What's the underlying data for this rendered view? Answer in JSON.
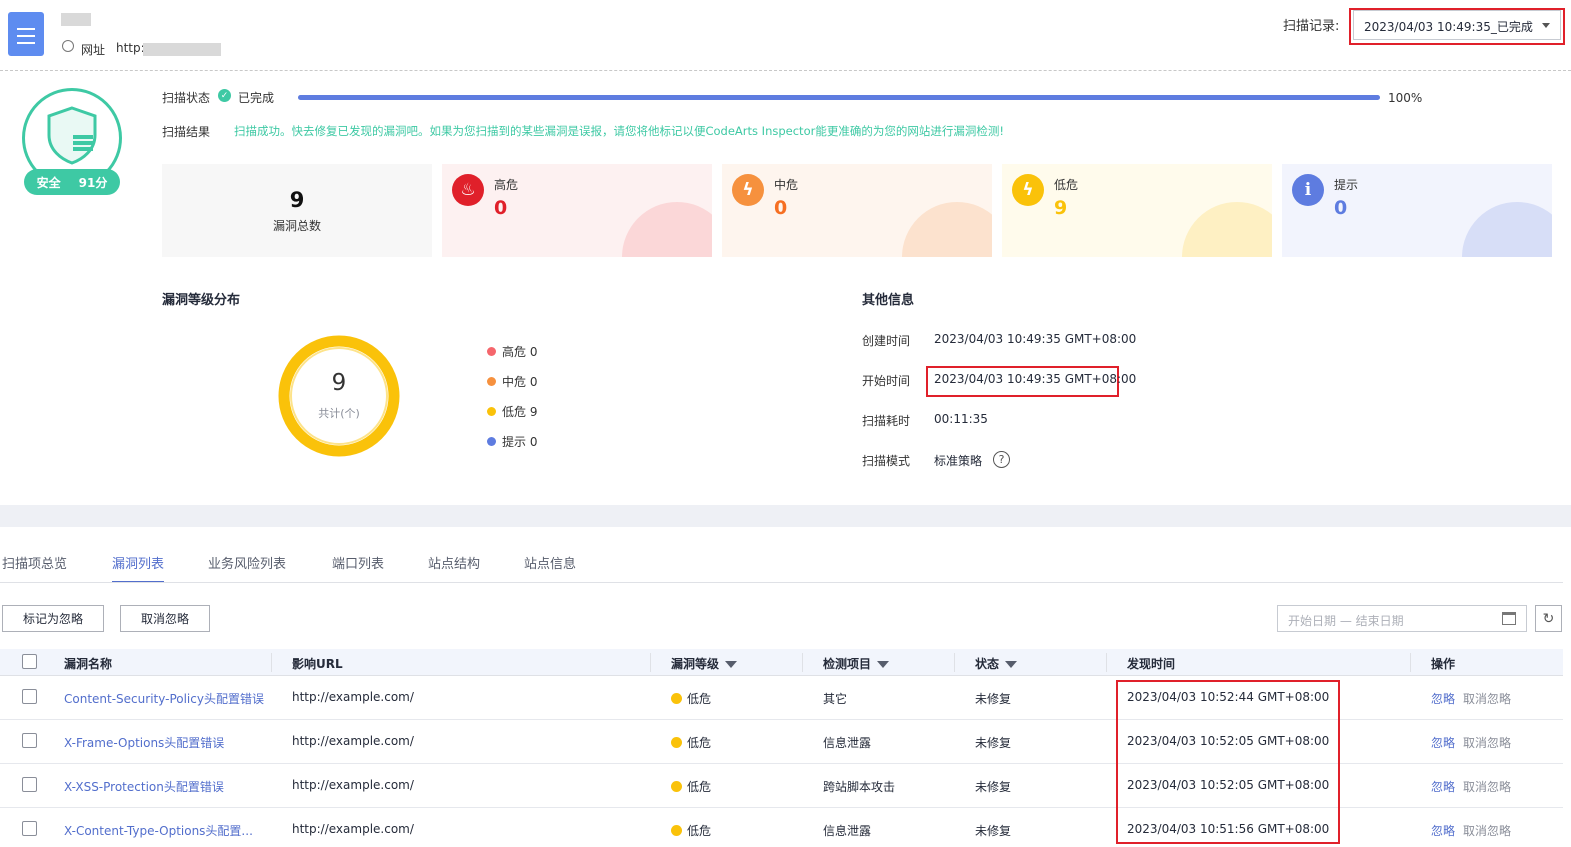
{
  "header": {
    "url_label": "网址",
    "url_prefix": "http:/",
    "scan_record_label": "扫描记录:",
    "scan_record_value": "2023/04/03 10:49:35_已完成"
  },
  "score": {
    "label": "安全",
    "value": "91分"
  },
  "scan": {
    "status_label": "扫描状态",
    "status_value": "已完成",
    "progress_percent": 100,
    "progress_text": "100%",
    "result_label": "扫描结果",
    "result_text": "扫描成功。快去修复已发现的漏洞吧。如果为您扫描到的某些漏洞是误报，请您将他标记以便CodeArts Inspector能更准确的为您的网站进行漏洞检测!"
  },
  "cards": {
    "total": {
      "value": "9",
      "label": "漏洞总数"
    },
    "high": {
      "label": "高危",
      "value": "0",
      "color": "#e0202a"
    },
    "medium": {
      "label": "中危",
      "value": "0",
      "color": "#f66f22"
    },
    "low": {
      "label": "低危",
      "value": "9",
      "color": "#fac20a"
    },
    "hint": {
      "label": "提示",
      "value": "0",
      "color": "#5e7ce0"
    }
  },
  "distribution": {
    "title": "漏洞等级分布",
    "total": "9",
    "total_label": "共计(个)",
    "legend": [
      {
        "label": "高危 0",
        "color": "#f5666c"
      },
      {
        "label": "中危 0",
        "color": "#f6913e"
      },
      {
        "label": "低危 9",
        "color": "#fac20a"
      },
      {
        "label": "提示 0",
        "color": "#5e7ce0"
      }
    ]
  },
  "other_info": {
    "title": "其他信息",
    "created_label": "创建时间",
    "created_value": "2023/04/03 10:49:35 GMT+08:00",
    "start_label": "开始时间",
    "start_value": "2023/04/03 10:49:35 GMT+08:00",
    "duration_label": "扫描耗时",
    "duration_value": "00:11:35",
    "mode_label": "扫描模式",
    "mode_value": "标准策略"
  },
  "tabs": [
    "扫描项总览",
    "漏洞列表",
    "业务风险列表",
    "端口列表",
    "站点结构",
    "站点信息"
  ],
  "toolbar": {
    "mark_ignore": "标记为忽略",
    "cancel_ignore": "取消忽略",
    "date_placeholder": "开始日期 — 结束日期"
  },
  "table": {
    "headers": [
      "漏洞名称",
      "影响URL",
      "漏洞等级",
      "检测项目",
      "状态",
      "发现时间",
      "操作"
    ],
    "rows": [
      {
        "name": "Content-Security-Policy头配置错误",
        "url": "http://example.com/",
        "level": "低危",
        "item": "其它",
        "status": "未修复",
        "time": "2023/04/03 10:52:44 GMT+08:00",
        "op1": "忽略",
        "op2": "取消忽略"
      },
      {
        "name": "X-Frame-Options头配置错误",
        "url": "http://example.com/",
        "level": "低危",
        "item": "信息泄露",
        "status": "未修复",
        "time": "2023/04/03 10:52:05 GMT+08:00",
        "op1": "忽略",
        "op2": "取消忽略"
      },
      {
        "name": "X-XSS-Protection头配置错误",
        "url": "http://example.com/",
        "level": "低危",
        "item": "跨站脚本攻击",
        "status": "未修复",
        "time": "2023/04/03 10:52:05 GMT+08:00",
        "op1": "忽略",
        "op2": "取消忽略"
      },
      {
        "name": "X-Content-Type-Options头配置...",
        "url": "http://example.com/",
        "level": "低危",
        "item": "信息泄露",
        "status": "未修复",
        "time": "2023/04/03 10:51:56 GMT+08:00",
        "op1": "忽略",
        "op2": "取消忽略"
      }
    ]
  }
}
